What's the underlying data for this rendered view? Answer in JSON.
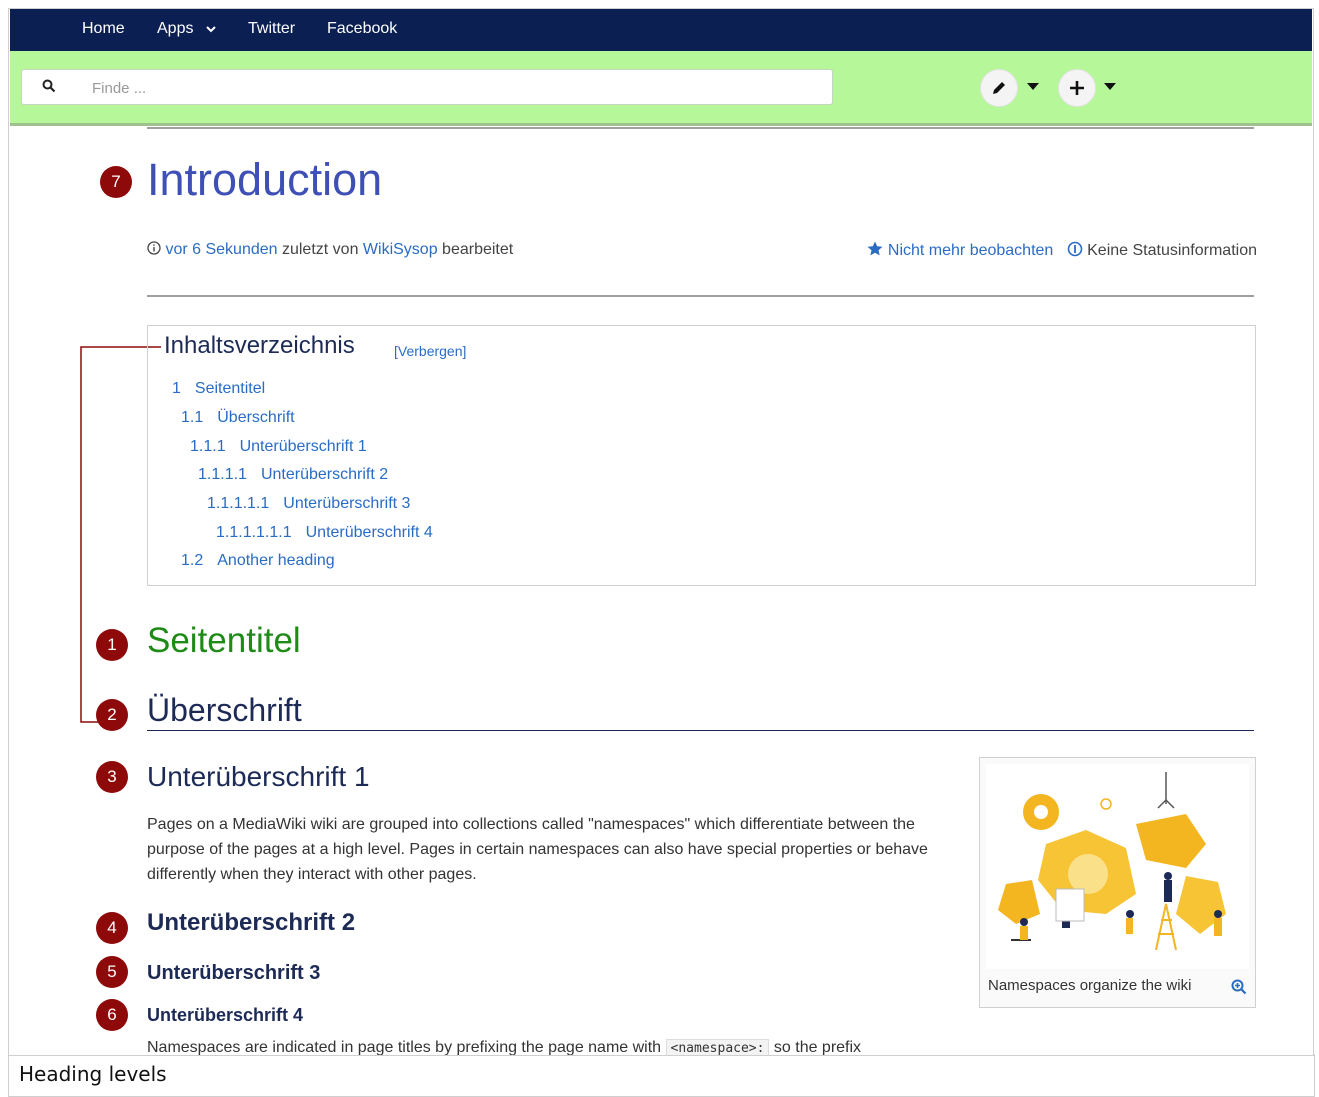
{
  "nav": {
    "home": "Home",
    "apps": "Apps",
    "twitter": "Twitter",
    "facebook": "Facebook"
  },
  "search": {
    "placeholder": "Finde ..."
  },
  "badges": [
    "7",
    "1",
    "2",
    "3",
    "4",
    "5",
    "6"
  ],
  "page": {
    "title": "Introduction",
    "meta": {
      "time": "vor 6 Sekunden",
      "middle": " zuletzt von ",
      "user": "WikiSysop",
      "end": " bearbeitet"
    },
    "unwatch": "Nicht mehr beobachten",
    "status": "Keine Statusinformation"
  },
  "toc": {
    "title": "Inhaltsverzeichnis",
    "toggle": "[Verbergen]",
    "items": [
      {
        "num": "1",
        "label": "Seitentitel"
      },
      {
        "num": "1.1",
        "label": "Überschrift"
      },
      {
        "num": "1.1.1",
        "label": "Unterüberschrift 1"
      },
      {
        "num": "1.1.1.1",
        "label": "Unterüberschrift 2"
      },
      {
        "num": "1.1.1.1.1",
        "label": "Unterüberschrift 3"
      },
      {
        "num": "1.1.1.1.1.1",
        "label": "Unterüberschrift 4"
      },
      {
        "num": "1.2",
        "label": "Another heading"
      }
    ]
  },
  "headings": {
    "seitentitel": "Seitentitel",
    "ueberschrift": "Überschrift",
    "u1": "Unterüberschrift 1",
    "u2": "Unterüberschrift 2",
    "u3": "Unterüberschrift 3",
    "u4": "Unterüberschrift 4"
  },
  "paragraph1": "Pages on a MediaWiki wiki are grouped into collections called \"namespaces\" which differentiate between the purpose of the pages at a high level. Pages in certain namespaces can also have special properties or behave differently when they interact with other pages.",
  "paragraph2": {
    "before": "Namespaces are indicated in page titles by prefixing the page name with ",
    "code": "<namespace>:",
    "after": " so the prefix"
  },
  "thumbnail": {
    "caption": "Namespaces organize the wiki"
  },
  "figure_caption": "Heading levels",
  "colors": {
    "nav": "#0b1f52",
    "searchbar": "#b6f899",
    "badge": "#8e0a0a",
    "title": "#3e4fb5",
    "link": "#2a6cc4",
    "seitentitel": "#1f8b17",
    "heading": "#1c2a55"
  }
}
